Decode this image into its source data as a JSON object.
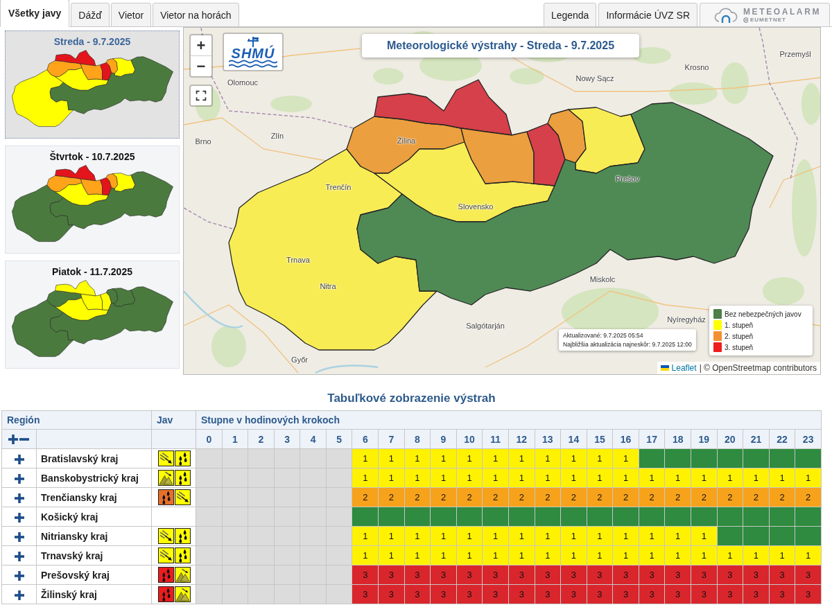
{
  "tabs": [
    {
      "label": "Všetky javy",
      "selected": true
    },
    {
      "label": "Dážď",
      "selected": false
    },
    {
      "label": "Vietor",
      "selected": false
    },
    {
      "label": "Vietor na horách",
      "selected": false
    }
  ],
  "header_buttons": [
    "Legenda",
    "Informácie ÚVZ SR"
  ],
  "meteoalarm": {
    "title": "METEOALARM",
    "subtitle": "EUMETNET"
  },
  "days": [
    {
      "title": "Streda - 9.7.2025",
      "selected": true,
      "zones": [
        {
          "color": "#ffff00"
        },
        {
          "color": "#ffa31a"
        },
        {
          "color": "#e3141b"
        },
        {
          "color": "#ffff00"
        },
        {
          "color": "#ffa31a"
        },
        {
          "color": "#e3141b"
        },
        {
          "color": "#ffa31a"
        },
        {
          "color": "#ffff00"
        },
        {
          "color": "#4b7a3e"
        }
      ]
    },
    {
      "title": "Štvrtok - 10.7.2025",
      "selected": false,
      "zones": [
        {
          "color": "#4b7a3e"
        },
        {
          "color": "#ffa31a"
        },
        {
          "color": "#e3141b"
        },
        {
          "color": "#ffff00"
        },
        {
          "color": "#ffa31a"
        },
        {
          "color": "#e3141b"
        },
        {
          "color": "#ffa31a"
        },
        {
          "color": "#ffff00"
        },
        {
          "color": "#4b7a3e"
        }
      ]
    },
    {
      "title": "Piatok - 11.7.2025",
      "selected": false,
      "zones": [
        {
          "color": "#4b7a3e"
        },
        {
          "color": "#4b7a3e"
        },
        {
          "color": "#ffff00"
        },
        {
          "color": "#ffff00"
        },
        {
          "color": "#ffff00"
        },
        {
          "color": "#ffff00"
        },
        {
          "color": "#4b7a3e"
        },
        {
          "color": "#4b7a3e"
        },
        {
          "color": "#4b7a3e"
        }
      ]
    }
  ],
  "map": {
    "zoom_in": "+",
    "zoom_out": "−",
    "logo_text": "SHMÚ",
    "title": "Meteorologické výstrahy - Streda - 9.7.2025",
    "zones": [
      {
        "color": "#f8ec55"
      },
      {
        "color": "#eb9f3e"
      },
      {
        "color": "#d5404a"
      },
      {
        "color": "#f8ec55"
      },
      {
        "color": "#eb9f3e"
      },
      {
        "color": "#d5404a"
      },
      {
        "color": "#eb9f3e"
      },
      {
        "color": "#f8ec55"
      },
      {
        "color": "#4f8a55"
      }
    ],
    "place_labels": [
      "Przemyśl",
      "Krosno",
      "Nowy Sącz",
      "Olomouc",
      "Zlín",
      "Brno",
      "Žilina",
      "Trenčín",
      "Slovensko",
      "Prešov",
      "Trnava",
      "Nitra",
      "Miskolc",
      "Salgótarján",
      "Nyíregyház",
      "Győr"
    ],
    "updated": "Aktualizované: 9.7.2025 05:54",
    "next_update": "Najbližšia aktualizácia najneskôr: 9.7.2025 12:00",
    "legend": [
      {
        "label": "Bez nebezpečných javov",
        "color": "#4d7f46"
      },
      {
        "label": "1. stupeň",
        "color": "#ffff00"
      },
      {
        "label": "2. stupeň",
        "color": "#f39033"
      },
      {
        "label": "3. stupeň",
        "color": "#ef1d1d"
      }
    ],
    "attribution": {
      "link": "Leaflet",
      "text": "| © OpenStreetmap contributors"
    }
  },
  "table": {
    "title": "Tabuľkové zobrazenie výstrah",
    "column_groups": [
      "Región",
      "Jav",
      "Stupne v hodinových krokoch"
    ],
    "hour_columns": [
      "0",
      "1",
      "2",
      "3",
      "4",
      "5",
      "6",
      "7",
      "8",
      "9",
      "10",
      "11",
      "12",
      "13",
      "14",
      "15",
      "16",
      "17",
      "18",
      "19",
      "20",
      "21",
      "22",
      "23"
    ],
    "rows": [
      {
        "region": "Bratislavský kraj",
        "expanded": false,
        "phenomena": [
          {
            "kind": "wind",
            "color": "#ffff00"
          },
          {
            "kind": "rain",
            "color": "#ffff00"
          }
        ],
        "cells": [
          {
            "color": "#dcdcdc"
          },
          {
            "color": "#dcdcdc"
          },
          {
            "color": "#dcdcdc"
          },
          {
            "color": "#dcdcdc"
          },
          {
            "color": "#dcdcdc"
          },
          {
            "color": "#dcdcdc"
          },
          {
            "text": "1",
            "color": "#fff200"
          },
          {
            "text": "1",
            "color": "#fff200"
          },
          {
            "text": "1",
            "color": "#fff200"
          },
          {
            "text": "1",
            "color": "#fff200"
          },
          {
            "text": "1",
            "color": "#fff200"
          },
          {
            "text": "1",
            "color": "#fff200"
          },
          {
            "text": "1",
            "color": "#fff200"
          },
          {
            "text": "1",
            "color": "#fff200"
          },
          {
            "text": "1",
            "color": "#fff200"
          },
          {
            "text": "1",
            "color": "#fff200"
          },
          {
            "text": "1",
            "color": "#fff200"
          },
          {
            "color": "#2e8b3f"
          },
          {
            "color": "#2e8b3f"
          },
          {
            "color": "#2e8b3f"
          },
          {
            "color": "#2e8b3f"
          },
          {
            "color": "#2e8b3f"
          },
          {
            "color": "#2e8b3f"
          },
          {
            "color": "#2e8b3f"
          }
        ]
      },
      {
        "region": "Banskobystrický kraj",
        "expanded": false,
        "phenomena": [
          {
            "kind": "mountain_wind",
            "color": "#ffff00"
          },
          {
            "kind": "rain",
            "color": "#ffff00"
          }
        ],
        "cells": [
          {
            "color": "#dcdcdc"
          },
          {
            "color": "#dcdcdc"
          },
          {
            "color": "#dcdcdc"
          },
          {
            "color": "#dcdcdc"
          },
          {
            "color": "#dcdcdc"
          },
          {
            "color": "#dcdcdc"
          },
          {
            "text": "1",
            "color": "#fff200"
          },
          {
            "text": "1",
            "color": "#fff200"
          },
          {
            "text": "1",
            "color": "#fff200"
          },
          {
            "text": "1",
            "color": "#fff200"
          },
          {
            "text": "1",
            "color": "#fff200"
          },
          {
            "text": "1",
            "color": "#fff200"
          },
          {
            "text": "1",
            "color": "#fff200"
          },
          {
            "text": "1",
            "color": "#fff200"
          },
          {
            "text": "1",
            "color": "#fff200"
          },
          {
            "text": "1",
            "color": "#fff200"
          },
          {
            "text": "1",
            "color": "#fff200"
          },
          {
            "text": "1",
            "color": "#fff200"
          },
          {
            "text": "1",
            "color": "#fff200"
          },
          {
            "text": "1",
            "color": "#fff200"
          },
          {
            "text": "1",
            "color": "#fff200"
          },
          {
            "text": "1",
            "color": "#fff200"
          },
          {
            "text": "1",
            "color": "#fff200"
          },
          {
            "text": "1",
            "color": "#fff200"
          }
        ]
      },
      {
        "region": "Trenčiansky kraj",
        "expanded": false,
        "phenomena": [
          {
            "kind": "rain",
            "color": "#e8702a"
          },
          {
            "kind": "wind",
            "color": "#ffff00"
          }
        ],
        "cells": [
          {
            "color": "#dcdcdc"
          },
          {
            "color": "#dcdcdc"
          },
          {
            "color": "#dcdcdc"
          },
          {
            "color": "#dcdcdc"
          },
          {
            "color": "#dcdcdc"
          },
          {
            "color": "#dcdcdc"
          },
          {
            "text": "2",
            "color": "#f7a21b"
          },
          {
            "text": "2",
            "color": "#f7a21b"
          },
          {
            "text": "2",
            "color": "#f7a21b"
          },
          {
            "text": "2",
            "color": "#f7a21b"
          },
          {
            "text": "2",
            "color": "#f7a21b"
          },
          {
            "text": "2",
            "color": "#f7a21b"
          },
          {
            "text": "2",
            "color": "#f7a21b"
          },
          {
            "text": "2",
            "color": "#f7a21b"
          },
          {
            "text": "2",
            "color": "#f7a21b"
          },
          {
            "text": "2",
            "color": "#f7a21b"
          },
          {
            "text": "2",
            "color": "#f7a21b"
          },
          {
            "text": "2",
            "color": "#f7a21b"
          },
          {
            "text": "2",
            "color": "#f7a21b"
          },
          {
            "text": "2",
            "color": "#f7a21b"
          },
          {
            "text": "2",
            "color": "#f7a21b"
          },
          {
            "text": "2",
            "color": "#f7a21b"
          },
          {
            "text": "2",
            "color": "#f7a21b"
          },
          {
            "text": "2",
            "color": "#f7a21b"
          }
        ]
      },
      {
        "region": "Košický kraj",
        "expanded": false,
        "cells": [
          {
            "color": "#dcdcdc"
          },
          {
            "color": "#dcdcdc"
          },
          {
            "color": "#dcdcdc"
          },
          {
            "color": "#dcdcdc"
          },
          {
            "color": "#dcdcdc"
          },
          {
            "color": "#dcdcdc"
          },
          {
            "color": "#2e8b3f"
          },
          {
            "color": "#2e8b3f"
          },
          {
            "color": "#2e8b3f"
          },
          {
            "color": "#2e8b3f"
          },
          {
            "color": "#2e8b3f"
          },
          {
            "color": "#2e8b3f"
          },
          {
            "color": "#2e8b3f"
          },
          {
            "color": "#2e8b3f"
          },
          {
            "color": "#2e8b3f"
          },
          {
            "color": "#2e8b3f"
          },
          {
            "color": "#2e8b3f"
          },
          {
            "color": "#2e8b3f"
          },
          {
            "color": "#2e8b3f"
          },
          {
            "color": "#2e8b3f"
          },
          {
            "color": "#2e8b3f"
          },
          {
            "color": "#2e8b3f"
          },
          {
            "color": "#2e8b3f"
          },
          {
            "color": "#2e8b3f"
          }
        ]
      },
      {
        "region": "Nitriansky kraj",
        "expanded": false,
        "phenomena": [
          {
            "kind": "wind",
            "color": "#ffff00"
          },
          {
            "kind": "rain",
            "color": "#ffff00"
          }
        ],
        "cells": [
          {
            "color": "#dcdcdc"
          },
          {
            "color": "#dcdcdc"
          },
          {
            "color": "#dcdcdc"
          },
          {
            "color": "#dcdcdc"
          },
          {
            "color": "#dcdcdc"
          },
          {
            "color": "#dcdcdc"
          },
          {
            "text": "1",
            "color": "#fff200"
          },
          {
            "text": "1",
            "color": "#fff200"
          },
          {
            "text": "1",
            "color": "#fff200"
          },
          {
            "text": "1",
            "color": "#fff200"
          },
          {
            "text": "1",
            "color": "#fff200"
          },
          {
            "text": "1",
            "color": "#fff200"
          },
          {
            "text": "1",
            "color": "#fff200"
          },
          {
            "text": "1",
            "color": "#fff200"
          },
          {
            "text": "1",
            "color": "#fff200"
          },
          {
            "text": "1",
            "color": "#fff200"
          },
          {
            "text": "1",
            "color": "#fff200"
          },
          {
            "text": "1",
            "color": "#fff200"
          },
          {
            "text": "1",
            "color": "#fff200"
          },
          {
            "text": "1",
            "color": "#fff200"
          },
          {
            "color": "#2e8b3f"
          },
          {
            "color": "#2e8b3f"
          },
          {
            "color": "#2e8b3f"
          },
          {
            "color": "#2e8b3f"
          }
        ]
      },
      {
        "region": "Trnavský kraj",
        "expanded": false,
        "phenomena": [
          {
            "kind": "wind",
            "color": "#ffff00"
          },
          {
            "kind": "rain",
            "color": "#ffff00"
          }
        ],
        "cells": [
          {
            "color": "#dcdcdc"
          },
          {
            "color": "#dcdcdc"
          },
          {
            "color": "#dcdcdc"
          },
          {
            "color": "#dcdcdc"
          },
          {
            "color": "#dcdcdc"
          },
          {
            "color": "#dcdcdc"
          },
          {
            "text": "1",
            "color": "#fff200"
          },
          {
            "text": "1",
            "color": "#fff200"
          },
          {
            "text": "1",
            "color": "#fff200"
          },
          {
            "text": "1",
            "color": "#fff200"
          },
          {
            "text": "1",
            "color": "#fff200"
          },
          {
            "text": "1",
            "color": "#fff200"
          },
          {
            "text": "1",
            "color": "#fff200"
          },
          {
            "text": "1",
            "color": "#fff200"
          },
          {
            "text": "1",
            "color": "#fff200"
          },
          {
            "text": "1",
            "color": "#fff200"
          },
          {
            "text": "1",
            "color": "#fff200"
          },
          {
            "text": "1",
            "color": "#fff200"
          },
          {
            "text": "1",
            "color": "#fff200"
          },
          {
            "text": "1",
            "color": "#fff200"
          },
          {
            "text": "1",
            "color": "#fff200"
          },
          {
            "text": "1",
            "color": "#fff200"
          },
          {
            "text": "1",
            "color": "#fff200"
          },
          {
            "text": "1",
            "color": "#fff200"
          }
        ]
      },
      {
        "region": "Prešovský kraj",
        "expanded": false,
        "phenomena": [
          {
            "kind": "rain",
            "color": "#ee1c1c"
          },
          {
            "kind": "mountain_wind",
            "color": "#ffff00"
          }
        ],
        "cells": [
          {
            "color": "#dcdcdc"
          },
          {
            "color": "#dcdcdc"
          },
          {
            "color": "#dcdcdc"
          },
          {
            "color": "#dcdcdc"
          },
          {
            "color": "#dcdcdc"
          },
          {
            "color": "#dcdcdc"
          },
          {
            "text": "3",
            "color": "#d9262c"
          },
          {
            "text": "3",
            "color": "#d9262c"
          },
          {
            "text": "3",
            "color": "#d9262c"
          },
          {
            "text": "3",
            "color": "#d9262c"
          },
          {
            "text": "3",
            "color": "#d9262c"
          },
          {
            "text": "3",
            "color": "#d9262c"
          },
          {
            "text": "3",
            "color": "#d9262c"
          },
          {
            "text": "3",
            "color": "#d9262c"
          },
          {
            "text": "3",
            "color": "#d9262c"
          },
          {
            "text": "3",
            "color": "#d9262c"
          },
          {
            "text": "3",
            "color": "#d9262c"
          },
          {
            "text": "3",
            "color": "#d9262c"
          },
          {
            "text": "3",
            "color": "#d9262c"
          },
          {
            "text": "3",
            "color": "#d9262c"
          },
          {
            "text": "3",
            "color": "#d9262c"
          },
          {
            "text": "3",
            "color": "#d9262c"
          },
          {
            "text": "3",
            "color": "#d9262c"
          },
          {
            "text": "3",
            "color": "#d9262c"
          }
        ]
      },
      {
        "region": "Žilinský kraj",
        "expanded": false,
        "phenomena": [
          {
            "kind": "rain",
            "color": "#ee1c1c"
          },
          {
            "kind": "mountain_wind",
            "color": "#ffff00"
          }
        ],
        "cells": [
          {
            "color": "#dcdcdc"
          },
          {
            "color": "#dcdcdc"
          },
          {
            "color": "#dcdcdc"
          },
          {
            "color": "#dcdcdc"
          },
          {
            "color": "#dcdcdc"
          },
          {
            "color": "#dcdcdc"
          },
          {
            "text": "3",
            "color": "#d9262c"
          },
          {
            "text": "3",
            "color": "#d9262c"
          },
          {
            "text": "3",
            "color": "#d9262c"
          },
          {
            "text": "3",
            "color": "#d9262c"
          },
          {
            "text": "3",
            "color": "#d9262c"
          },
          {
            "text": "3",
            "color": "#d9262c"
          },
          {
            "text": "3",
            "color": "#d9262c"
          },
          {
            "text": "3",
            "color": "#d9262c"
          },
          {
            "text": "3",
            "color": "#d9262c"
          },
          {
            "text": "3",
            "color": "#d9262c"
          },
          {
            "text": "3",
            "color": "#d9262c"
          },
          {
            "text": "3",
            "color": "#d9262c"
          },
          {
            "text": "3",
            "color": "#d9262c"
          },
          {
            "text": "3",
            "color": "#d9262c"
          },
          {
            "text": "3",
            "color": "#d9262c"
          },
          {
            "text": "3",
            "color": "#d9262c"
          },
          {
            "text": "3",
            "color": "#d9262c"
          },
          {
            "text": "3",
            "color": "#d9262c"
          }
        ]
      }
    ]
  }
}
